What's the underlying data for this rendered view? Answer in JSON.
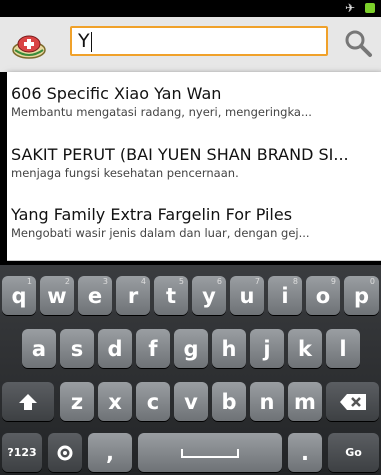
{
  "status": {
    "icons": [
      "airplane-icon",
      "battery-icon"
    ]
  },
  "search": {
    "value": "Y",
    "placeholder": ""
  },
  "suggestions": [
    {
      "title": "606 Specific Xiao Yan Wan",
      "subtitle": "Membantu mengatasi radang, nyeri, mengeringka..."
    },
    {
      "title": "SAKIT PERUT (BAI YUEN SHAN BRAND SI...",
      "subtitle": "menjaga fungsi kesehatan pencernaan."
    },
    {
      "title": "Yang Family Extra Fargelin For Piles",
      "subtitle": "Mengobati wasir jenis dalam dan luar, dengan gej..."
    }
  ],
  "keyboard": {
    "row1": [
      "q",
      "w",
      "e",
      "r",
      "t",
      "y",
      "u",
      "i",
      "o",
      "p"
    ],
    "row1_hints": [
      "1",
      "2",
      "3",
      "4",
      "5",
      "6",
      "7",
      "8",
      "9",
      "0"
    ],
    "row2": [
      "a",
      "s",
      "d",
      "f",
      "g",
      "h",
      "j",
      "k",
      "l"
    ],
    "row3": [
      "z",
      "x",
      "c",
      "v",
      "b",
      "n",
      "m"
    ],
    "numbers_label": "?123",
    "comma_label": ",",
    "period_label": ".",
    "go_label": "Go"
  },
  "colors": {
    "accent": "#f0a12a",
    "key": "#8a8e92",
    "keyboard_bg": "#2b2d30"
  }
}
